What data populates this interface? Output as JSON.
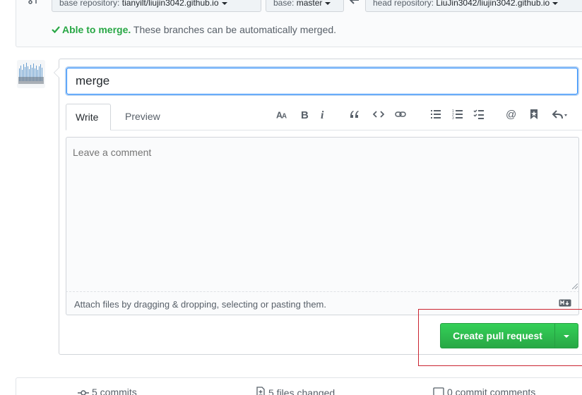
{
  "compare": {
    "base_repository_label": "base repository:",
    "base_repository_value": "tianyilt/liujin3042.github.io",
    "base_label": "base:",
    "base_value": "master",
    "head_repository_label": "head repository:",
    "head_repository_value": "LiuJin3042/liujin3042.github.io",
    "merge_status_ok": "Able to merge.",
    "merge_status_text": "These branches can be automatically merged."
  },
  "pull_request": {
    "title_value": "merge",
    "tabs": [
      {
        "label": "Write"
      },
      {
        "label": "Preview"
      }
    ],
    "toolbar_icons": [
      "text-size-icon",
      "bold-icon",
      "italic-icon",
      "quote-icon",
      "code-icon",
      "link-icon",
      "unordered-list-icon",
      "ordered-list-icon",
      "task-list-icon",
      "mention-icon",
      "bookmark-icon",
      "reply-icon"
    ],
    "comment_placeholder": "Leave a comment",
    "attach_text": "Attach files by dragging & dropping, selecting or pasting them.",
    "create_button_label": "Create pull request"
  },
  "stats": {
    "commits": "5 commits",
    "files_changed": "5 files changed",
    "commit_comments": "0 commit comments"
  },
  "colors": {
    "accent_green": "#28a745",
    "focus_blue": "#2188ff",
    "highlight_red": "#cb2431"
  }
}
